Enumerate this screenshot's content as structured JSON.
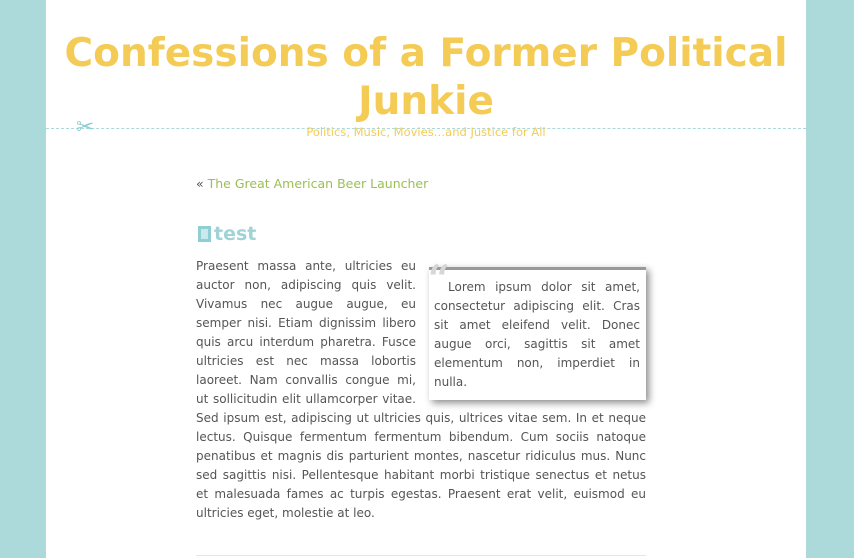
{
  "site": {
    "title": "Confessions of a Former Political Junkie",
    "tagline": "Politics, Music, Movies…and Justice for All"
  },
  "nav": {
    "prev_prefix": "« ",
    "prev_link_label": "The Great American Beer Launcher"
  },
  "post": {
    "title": "test",
    "body": "Praesent massa ante, ultricies eu auctor non, adipiscing quis velit. Vivamus nec augue augue, eu semper nisi. Etiam dignissim libero quis arcu interdum pharetra. Fusce ultricies est nec massa lobortis laoreet. Nam convallis congue mi, ut sollicitudin elit ullamcorper vitae. Sed ipsum est, adipiscing ut ultricies quis, ultrices vitae sem. In et neque lectus. Quisque fermentum fermentum bibendum. Cum sociis natoque penatibus et magnis dis parturient montes, nascetur ridiculus mus. Nunc sed sagittis nisi. Pellentesque habitant morbi tristique senectus et netus et malesuada fames ac turpis egestas. Praesent erat velit, euismod eu ultricies eget, molestie at leo.",
    "pullquote": "Lorem ipsum dolor sit amet, consectetur adipiscing elit. Cras sit amet eleifend velit. Donec augue orci, sagittis sit amet elementum non, imperdiet in nulla."
  },
  "icons": {
    "scissors": "scissors-icon",
    "post_type": "document-icon",
    "quote": "quote-icon"
  },
  "colors": {
    "background": "#acdadb",
    "title": "#f3cb55",
    "link": "#9bbf52",
    "post_title": "#9fd3d6"
  }
}
